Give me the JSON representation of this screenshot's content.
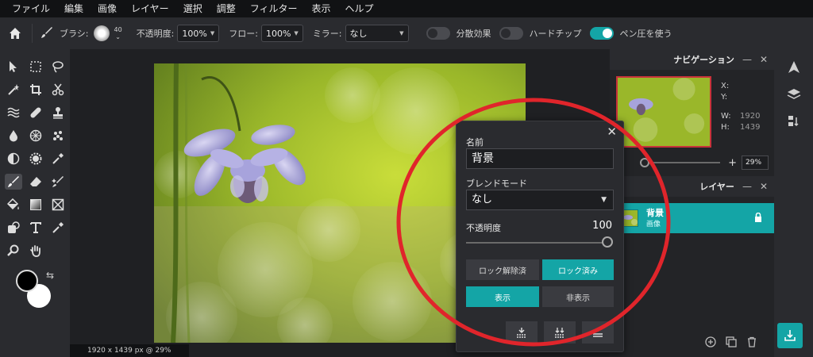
{
  "menu": [
    "ファイル",
    "編集",
    "画像",
    "レイヤー",
    "選択",
    "調整",
    "フィルター",
    "表示",
    "ヘルプ"
  ],
  "options": {
    "brush_label": "ブラシ:",
    "brush_size": "40",
    "opacity_label": "不透明度:",
    "opacity_value": "100%",
    "flow_label": "フロー:",
    "flow_value": "100%",
    "mirror_label": "ミラー:",
    "mirror_value": "なし",
    "scatter_label": "分散効果",
    "hard_tip_label": "ハードチップ",
    "pen_pressure_label": "ペン圧を使う",
    "scatter_on": false,
    "hard_tip_on": false,
    "pen_pressure_on": true
  },
  "status": "1920 x 1439 px @ 29%",
  "navigator": {
    "title": "ナビゲーション",
    "x_label": "X:",
    "y_label": "Y:",
    "w_label": "W:",
    "w_value": "1920",
    "h_label": "H:",
    "h_value": "1439",
    "zoom": "29%"
  },
  "layers": {
    "title": "レイヤー",
    "items": [
      {
        "name": "背景",
        "type": "画像",
        "locked": true
      }
    ]
  },
  "layer_props": {
    "name_label": "名前",
    "name_value": "背景",
    "blend_label": "ブレンドモード",
    "blend_value": "なし",
    "opacity_label": "不透明度",
    "opacity_value": "100",
    "opacity_fraction": 1.0,
    "unlock_label": "ロック解除済",
    "locked_label": "ロック済み",
    "show_label": "表示",
    "hide_label": "非表示",
    "locked": true,
    "visible": true
  },
  "colors": {
    "accent": "#14a5a6",
    "annotation": "#e0252b",
    "foreground": "#000000",
    "background": "#ffffff"
  }
}
